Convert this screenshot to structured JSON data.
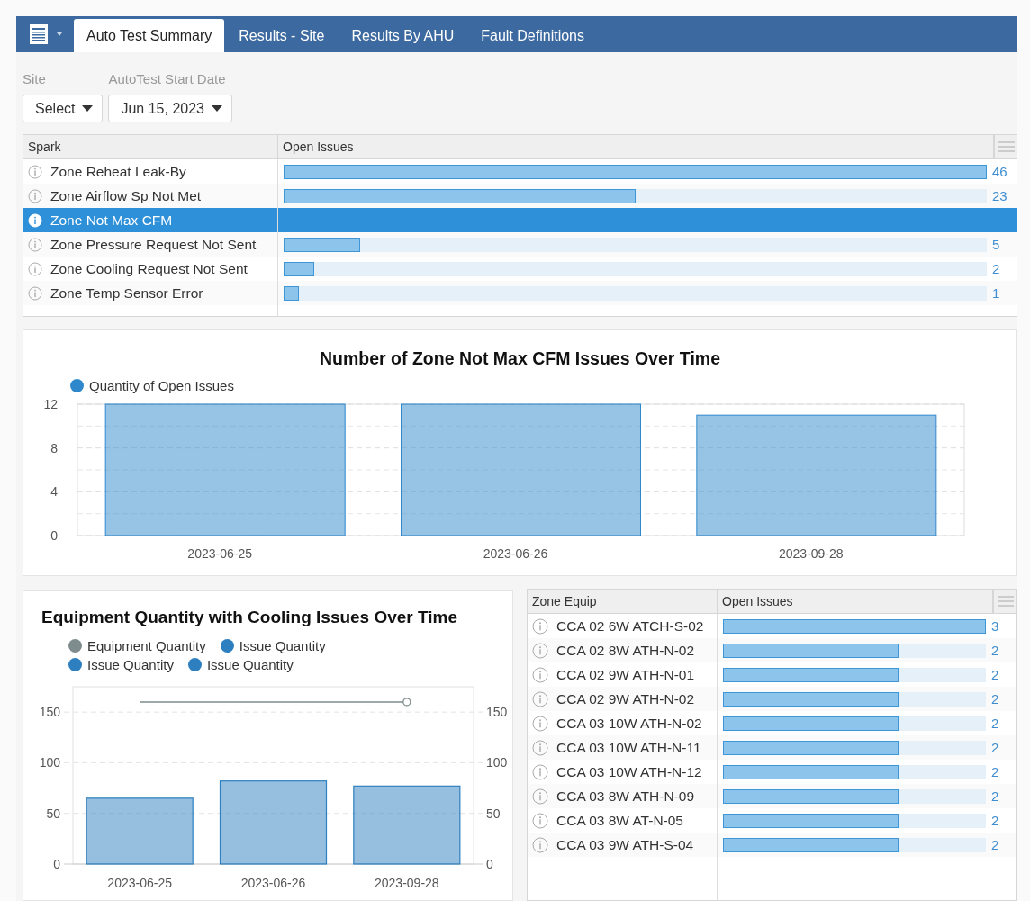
{
  "tabs": [
    {
      "label": "Auto Test Summary",
      "selected": true
    },
    {
      "label": "Results - Site",
      "selected": false
    },
    {
      "label": "Results By AHU",
      "selected": false
    },
    {
      "label": "Fault Definitions",
      "selected": false
    }
  ],
  "filters": [
    {
      "label": "Site",
      "value": "Select"
    },
    {
      "label": "AutoTest Start Date",
      "value": "Jun 15, 2023"
    }
  ],
  "spark_table": {
    "columns": [
      "Spark",
      "Open Issues"
    ],
    "rows": [
      {
        "name": "Zone Reheat Leak-By",
        "selected": false,
        "level": 1,
        "count": "46"
      },
      {
        "name": "Zone Airflow Sp Not Met",
        "selected": false,
        "level": 0.5,
        "count": "23"
      },
      {
        "name": "Zone Not Max CFM",
        "selected": true
      },
      {
        "name": "Zone Pressure Request Not Sent",
        "selected": false,
        "level": 0.109,
        "count": "5"
      },
      {
        "name": "Zone Cooling Request Not Sent",
        "selected": false,
        "level": 0.043,
        "count": "2"
      },
      {
        "name": "Zone Temp Sensor Error",
        "selected": false,
        "level": 0.022,
        "count": "1"
      }
    ]
  },
  "issues_chart": {
    "chart_data": {
      "type": "bar",
      "title": "Number of Zone Not Max CFM Issues Over Time",
      "categories": [
        "2023-06-25",
        "2023-06-26",
        "2023-09-28"
      ],
      "series": [
        {
          "name": "Quantity of Open Issues",
          "color": "#2f88cc",
          "values": [
            12,
            12,
            11
          ]
        }
      ],
      "legend": true,
      "grid": true,
      "ylim": [
        0,
        12
      ],
      "yticks": [
        0,
        4,
        8,
        12
      ]
    }
  },
  "equipment_chart": {
    "chart_data": {
      "type": "bar",
      "title": "Equipment Quantity with Cooling Issues Over Time",
      "categories": [
        "2023-06-25",
        "2023-06-26",
        "2023-09-28"
      ],
      "series": [
        {
          "name": "Equipment Quantity",
          "type": "line",
          "color": "#7f8c8d",
          "values": [
            160,
            160,
            160
          ]
        },
        {
          "name": "Issue Quantity",
          "type": "bar",
          "color": "#2e7fbf",
          "values": [
            65,
            82,
            77
          ]
        },
        {
          "name": "Issue Quantity",
          "type": "bar",
          "color": "#2e7fbf",
          "values": [
            null,
            null,
            null
          ]
        },
        {
          "name": "Issue Quantity",
          "type": "bar",
          "color": "#2e7fbf",
          "values": [
            null,
            null,
            null
          ]
        }
      ],
      "legend": true,
      "grid": true,
      "ylim": [
        0,
        175
      ],
      "yticks": [
        0,
        50,
        100,
        150
      ],
      "y2lim": [
        0,
        175
      ],
      "y2ticks": [
        0,
        50,
        100,
        150
      ]
    }
  },
  "equip_table": {
    "columns": [
      "Zone Equip",
      "Open Issues"
    ],
    "rows": [
      {
        "name": "CCA 02 6W ATCH-S-02",
        "level": 1,
        "count": "3"
      },
      {
        "name": "CCA 02 8W ATH-N-02",
        "level": 0.667,
        "count": "2"
      },
      {
        "name": "CCA 02 9W ATH-N-01",
        "level": 0.667,
        "count": "2"
      },
      {
        "name": "CCA 02 9W ATH-N-02",
        "level": 0.667,
        "count": "2"
      },
      {
        "name": "CCA 03 10W ATH-N-02",
        "level": 0.667,
        "count": "2"
      },
      {
        "name": "CCA 03 10W ATH-N-11",
        "level": 0.667,
        "count": "2"
      },
      {
        "name": "CCA 03 10W ATH-N-12",
        "level": 0.667,
        "count": "2"
      },
      {
        "name": "CCA 03 8W ATH-N-09",
        "level": 0.667,
        "count": "2"
      },
      {
        "name": "CCA 03 8W AT-N-05",
        "level": 0.667,
        "count": "2"
      },
      {
        "name": "CCA 03 9W ATH-S-04",
        "level": 0.667,
        "count": "2"
      }
    ]
  }
}
